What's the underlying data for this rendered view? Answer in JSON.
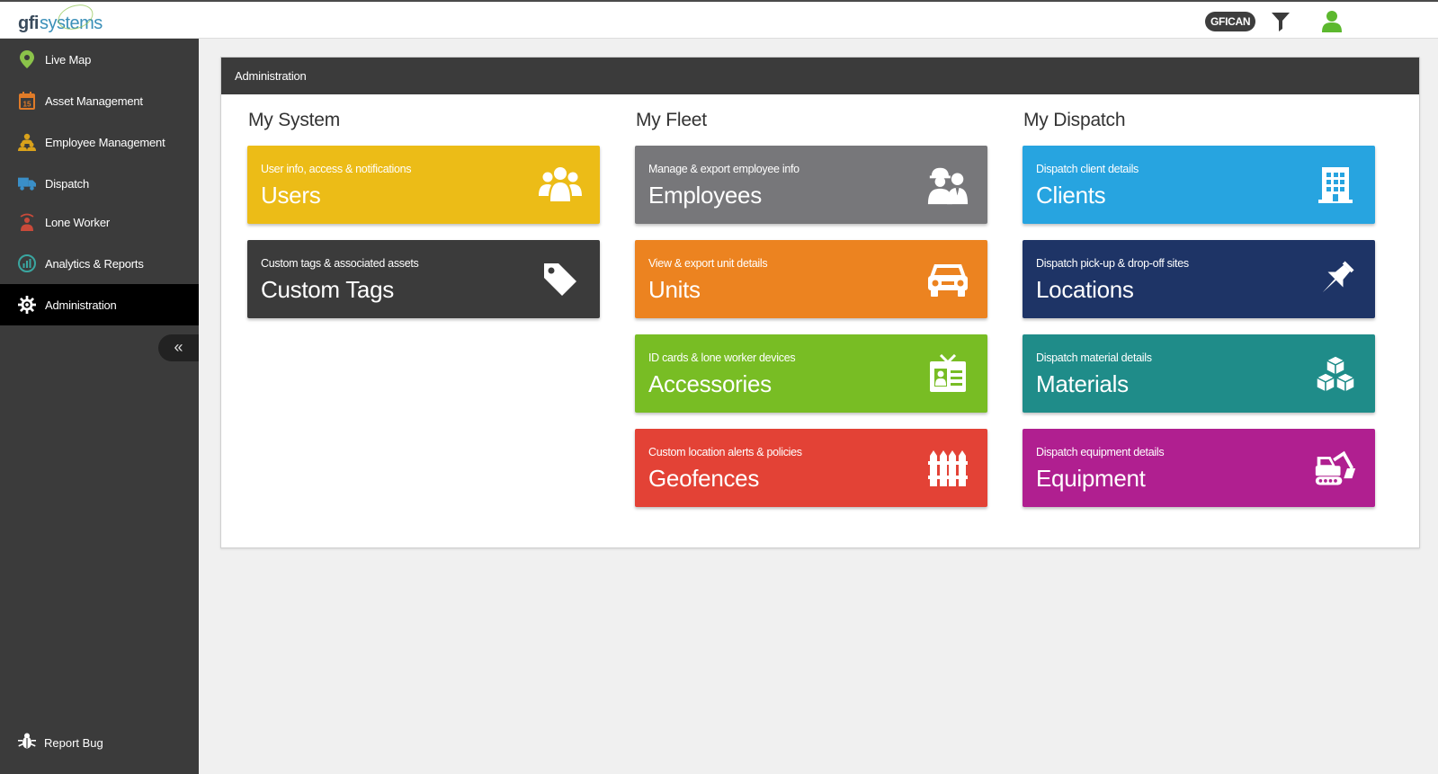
{
  "header": {
    "logo_gfi": "gfi",
    "logo_systems": "systems",
    "account_badge": "GFICAN",
    "filter_icon": "filter-icon",
    "user_icon": "user-icon"
  },
  "sidebar": {
    "items": [
      {
        "label": "Live Map",
        "icon": "map-pin-icon",
        "color": "#8bc34a"
      },
      {
        "label": "Asset Management",
        "icon": "calendar-icon",
        "color": "#e07b28"
      },
      {
        "label": "Employee Management",
        "icon": "employees-icon",
        "color": "#d9a21b"
      },
      {
        "label": "Dispatch",
        "icon": "truck-icon",
        "color": "#3a8fc8"
      },
      {
        "label": "Lone Worker",
        "icon": "worker-icon",
        "color": "#c94a3a"
      },
      {
        "label": "Analytics & Reports",
        "icon": "analytics-icon",
        "color": "#3aa6a0"
      },
      {
        "label": "Administration",
        "icon": "gear-icon",
        "color": "#ffffff",
        "active": true
      }
    ],
    "collapse_label": "«",
    "report_bug": "Report Bug"
  },
  "panel": {
    "title": "Administration",
    "columns": [
      {
        "title": "My System"
      },
      {
        "title": "My Fleet"
      },
      {
        "title": "My Dispatch"
      }
    ],
    "tiles": {
      "users": {
        "sub": "User info, access & notifications",
        "main": "Users",
        "color": "#ecbc17",
        "icon": "users-icon"
      },
      "custom_tags": {
        "sub": "Custom tags & associated assets",
        "main": "Custom Tags",
        "color": "#3b3b3b",
        "icon": "tag-icon"
      },
      "employees": {
        "sub": "Manage & export employee info",
        "main": "Employees",
        "color": "#77777a",
        "icon": "employees-icon"
      },
      "units": {
        "sub": "View & export unit details",
        "main": "Units",
        "color": "#ec8320",
        "icon": "car-icon"
      },
      "accessories": {
        "sub": "ID cards & lone worker devices",
        "main": "Accessories",
        "color": "#78bd24",
        "icon": "id-card-icon"
      },
      "geofences": {
        "sub": "Custom location alerts & policies",
        "main": "Geofences",
        "color": "#e34236",
        "icon": "fence-icon"
      },
      "clients": {
        "sub": "Dispatch client details",
        "main": "Clients",
        "color": "#27a4e0",
        "icon": "building-icon"
      },
      "locations": {
        "sub": "Dispatch pick-up & drop-off sites",
        "main": "Locations",
        "color": "#1e3466",
        "icon": "pushpin-icon"
      },
      "materials": {
        "sub": "Dispatch material details",
        "main": "Materials",
        "color": "#1f8c89",
        "icon": "cubes-icon"
      },
      "equipment": {
        "sub": "Dispatch equipment details",
        "main": "Equipment",
        "color": "#b01f90",
        "icon": "excavator-icon"
      }
    }
  }
}
